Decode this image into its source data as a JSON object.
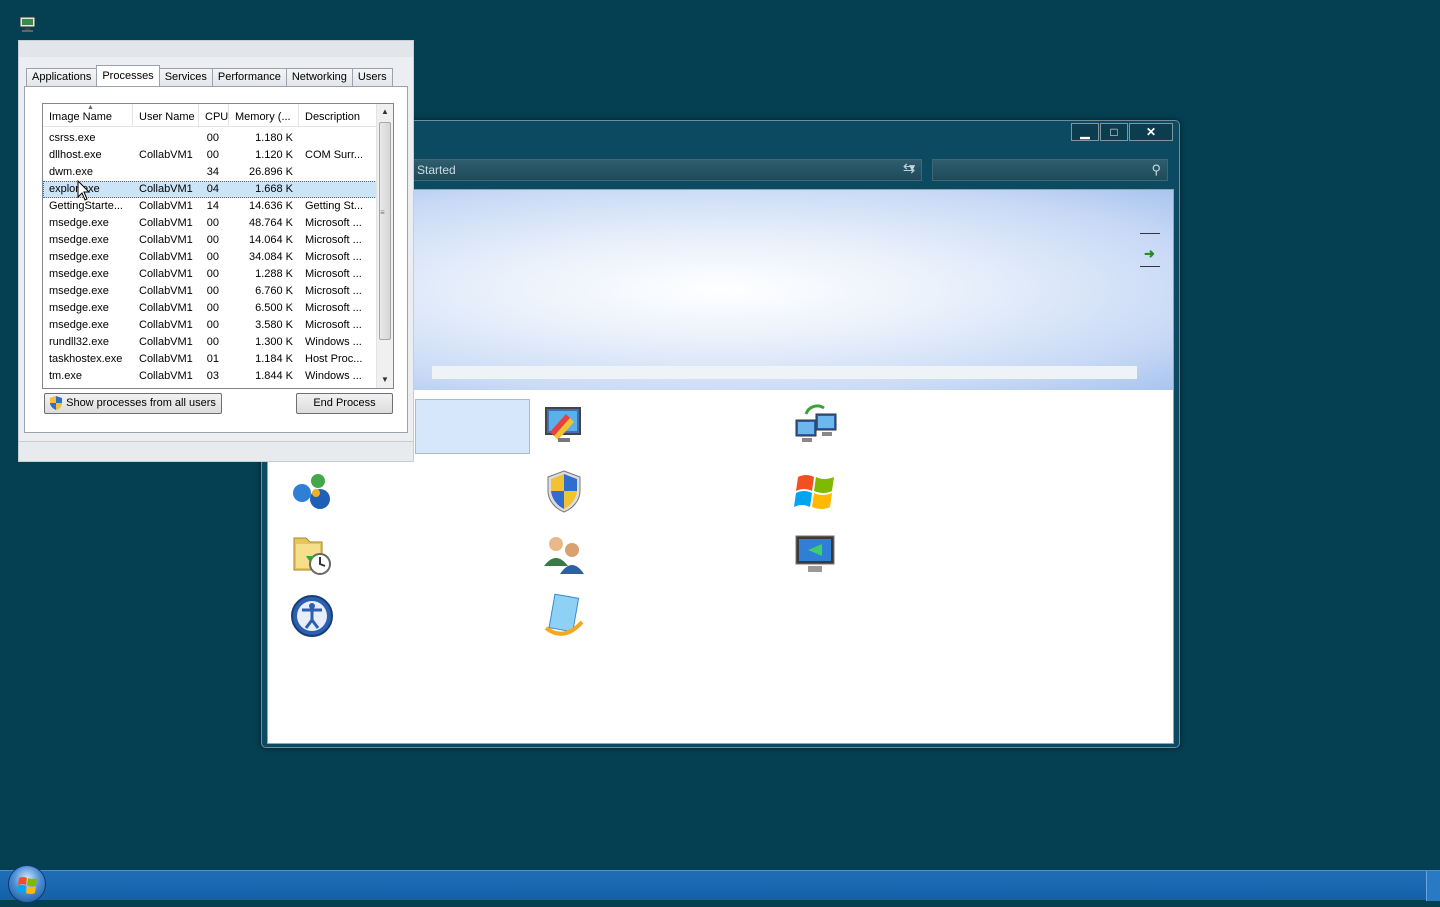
{
  "desktop": {
    "icon": "monitor-computer-icon"
  },
  "getting_started": {
    "address_text": "Started",
    "address_dropdown_icon": "chevron-down-icon",
    "refresh_icon": "refresh-icon",
    "search_icon": "search-icon",
    "caption": {
      "minimize": "▁",
      "maximize": "□",
      "close": "✕"
    },
    "arrow_icon": "green-arrow-icon",
    "tiles": [
      "personalize-icon",
      "transfer-computers-icon",
      "windows-live-icon",
      "security-shield-icon",
      "windows-logo-icon",
      "backup-restore-icon",
      "user-accounts-icon",
      "remote-desktop-icon",
      "ease-of-access-icon",
      "windows-media-icon"
    ]
  },
  "task_manager": {
    "tabs": [
      "Applications",
      "Processes",
      "Services",
      "Performance",
      "Networking",
      "Users"
    ],
    "active_tab": "Processes",
    "columns": [
      "Image Name",
      "User Name",
      "CPU",
      "Memory (...",
      "Description"
    ],
    "rows": [
      {
        "name": "csrss.exe",
        "user": "",
        "cpu": "00",
        "mem": "1.180 K",
        "desc": ""
      },
      {
        "name": "dllhost.exe",
        "user": "CollabVM1",
        "cpu": "00",
        "mem": "1.120 K",
        "desc": "COM Surr..."
      },
      {
        "name": "dwm.exe",
        "user": "",
        "cpu": "34",
        "mem": "26.896 K",
        "desc": ""
      },
      {
        "name": "explor  exe",
        "user": "CollabVM1",
        "cpu": "04",
        "mem": "1.668 K",
        "desc": "",
        "selected": true
      },
      {
        "name": "GettingStarte...",
        "user": "CollabVM1",
        "cpu": "14",
        "mem": "14.636 K",
        "desc": "Getting St..."
      },
      {
        "name": "msedge.exe",
        "user": "CollabVM1",
        "cpu": "00",
        "mem": "48.764 K",
        "desc": "Microsoft ..."
      },
      {
        "name": "msedge.exe",
        "user": "CollabVM1",
        "cpu": "00",
        "mem": "14.064 K",
        "desc": "Microsoft ..."
      },
      {
        "name": "msedge.exe",
        "user": "CollabVM1",
        "cpu": "00",
        "mem": "34.084 K",
        "desc": "Microsoft ..."
      },
      {
        "name": "msedge.exe",
        "user": "CollabVM1",
        "cpu": "00",
        "mem": "1.288 K",
        "desc": "Microsoft ..."
      },
      {
        "name": "msedge.exe",
        "user": "CollabVM1",
        "cpu": "00",
        "mem": "6.760 K",
        "desc": "Microsoft ..."
      },
      {
        "name": "msedge.exe",
        "user": "CollabVM1",
        "cpu": "00",
        "mem": "6.500 K",
        "desc": "Microsoft ..."
      },
      {
        "name": "msedge.exe",
        "user": "CollabVM1",
        "cpu": "00",
        "mem": "3.580 K",
        "desc": "Microsoft ..."
      },
      {
        "name": "rundll32.exe",
        "user": "CollabVM1",
        "cpu": "00",
        "mem": "1.300 K",
        "desc": "Windows ..."
      },
      {
        "name": "taskhostex.exe",
        "user": "CollabVM1",
        "cpu": "01",
        "mem": "1.184 K",
        "desc": "Host Proc..."
      },
      {
        "name": "tm.exe",
        "user": "CollabVM1",
        "cpu": "03",
        "mem": "1.844 K",
        "desc": "Windows ..."
      }
    ],
    "show_all_label": "Show processes from all users",
    "end_process_label": "End Process",
    "shield_icon": "uac-shield-icon"
  },
  "taskbar": {
    "start_icon": "windows-start-orb-icon"
  }
}
